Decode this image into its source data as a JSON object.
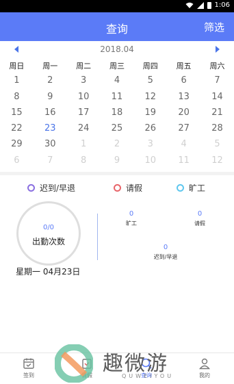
{
  "status_bar": {
    "time": "1:06"
  },
  "app_bar": {
    "title": "查询",
    "filter_label": "筛选"
  },
  "calendar": {
    "month": "2018.04",
    "weekdays": [
      "周日",
      "周一",
      "周二",
      "周三",
      "周四",
      "周五",
      "周六"
    ],
    "rows": [
      [
        "1",
        "2",
        "3",
        "4",
        "5",
        "6",
        "7"
      ],
      [
        "8",
        "9",
        "10",
        "11",
        "12",
        "13",
        "14"
      ],
      [
        "15",
        "16",
        "17",
        "18",
        "19",
        "20",
        "21"
      ],
      [
        "22",
        "23",
        "24",
        "25",
        "26",
        "27",
        "28"
      ],
      [
        "29",
        "30",
        "1",
        "2",
        "3",
        "4",
        "5"
      ],
      [
        "6",
        "7",
        "8",
        "9",
        "10",
        "11",
        "12"
      ]
    ],
    "today": "23"
  },
  "legend": {
    "late": {
      "label": "迟到/早退",
      "color": "#8a6fe0"
    },
    "leave": {
      "label": "请假",
      "color": "#e8656a"
    },
    "absent": {
      "label": "旷工",
      "color": "#5fc7ee"
    }
  },
  "summary": {
    "count_ratio": "0/0",
    "count_label": "出勤次数",
    "absent": {
      "value": "0",
      "label": "旷工"
    },
    "leave": {
      "value": "0",
      "label": "请假"
    },
    "late": {
      "value": "0",
      "label": "迟到/早退"
    },
    "selected_date": "星期一  04月23日"
  },
  "tabbar": {
    "tabs": [
      {
        "label": "签到",
        "icon": "calendar-check-icon"
      },
      {
        "label": "请假",
        "icon": "leave-form-icon"
      },
      {
        "label": "查询",
        "icon": "search-icon"
      },
      {
        "label": "我的",
        "icon": "user-icon"
      }
    ]
  },
  "watermark": {
    "text": "趣微游",
    "sub": "QUWEIYOU"
  }
}
